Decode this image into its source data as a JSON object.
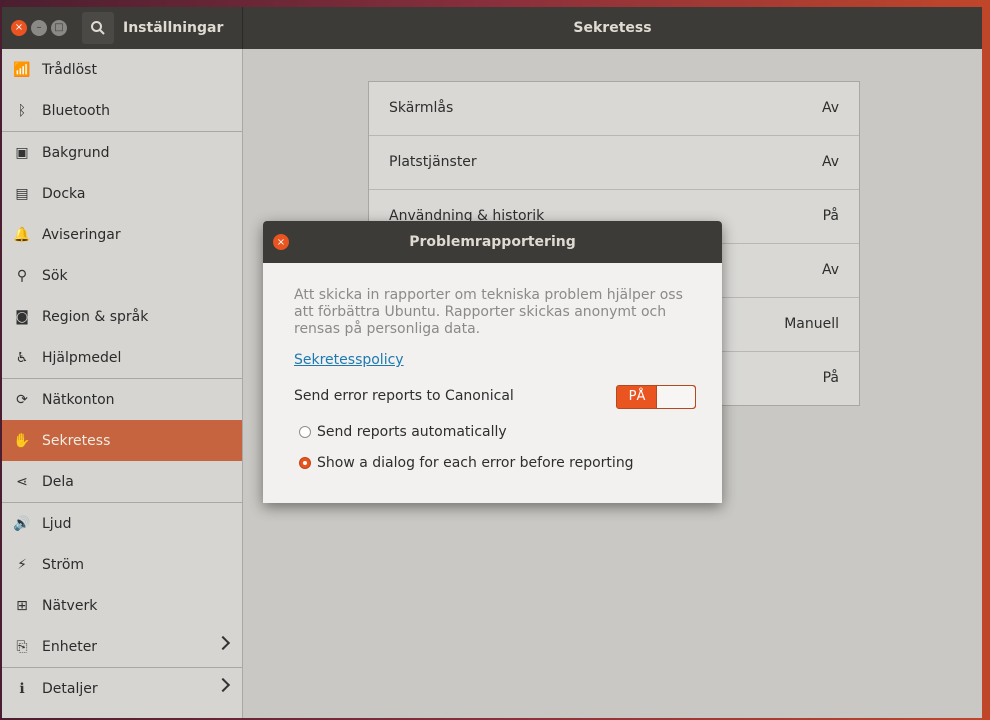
{
  "app": {
    "title": "Inställningar",
    "page_title": "Sekretess"
  },
  "window_controls": {
    "close": "×",
    "minimize": "–",
    "maximize": "□"
  },
  "sidebar": {
    "items": [
      {
        "label": "Trådlöst",
        "icon": "wifi-icon",
        "glyph": "📶"
      },
      {
        "label": "Bluetooth",
        "icon": "bluetooth-icon",
        "glyph": "ᛒ"
      },
      {
        "label": "Bakgrund",
        "icon": "background-icon",
        "glyph": "▣"
      },
      {
        "label": "Docka",
        "icon": "dock-icon",
        "glyph": "▤"
      },
      {
        "label": "Aviseringar",
        "icon": "bell-icon",
        "glyph": "🔔"
      },
      {
        "label": "Sök",
        "icon": "search-icon",
        "glyph": "⚲"
      },
      {
        "label": "Region & språk",
        "icon": "camera-icon",
        "glyph": "◙"
      },
      {
        "label": "Hjälpmedel",
        "icon": "accessibility-icon",
        "glyph": "♿"
      },
      {
        "label": "Nätkonton",
        "icon": "online-accounts-icon",
        "glyph": "⟳"
      },
      {
        "label": "Sekretess",
        "icon": "hand-icon",
        "glyph": "✋"
      },
      {
        "label": "Dela",
        "icon": "share-icon",
        "glyph": "⋖"
      },
      {
        "label": "Ljud",
        "icon": "speaker-icon",
        "glyph": "🔊"
      },
      {
        "label": "Ström",
        "icon": "power-icon",
        "glyph": "⚡"
      },
      {
        "label": "Nätverk",
        "icon": "network-icon",
        "glyph": "⊞"
      },
      {
        "label": "Enheter",
        "icon": "devices-icon",
        "glyph": "⎘"
      },
      {
        "label": "Detaljer",
        "icon": "info-icon",
        "glyph": "ℹ"
      }
    ]
  },
  "privacy_list": [
    {
      "label": "Skärmlås",
      "value": "Av"
    },
    {
      "label": "Platstjänster",
      "value": "Av"
    },
    {
      "label": "Användning & historik",
      "value": "På"
    },
    {
      "label": "",
      "value": "Av"
    },
    {
      "label": "",
      "value": "Manuell"
    },
    {
      "label": "",
      "value": "På"
    }
  ],
  "dialog": {
    "title": "Problemrapportering",
    "description": "Att skicka in rapporter om tekniska problem hjälper oss att förbättra Ubuntu. Rapporter skickas anonymt och rensas på personliga data.",
    "link": "Sekretesspolicy",
    "switch_label": "Send error reports to Canonical",
    "switch_state": "PÅ",
    "radio_auto": "Send reports automatically",
    "radio_dialog": "Show a dialog for each error before reporting"
  },
  "colors": {
    "accent": "#e95420",
    "titlebar": "#3c3b37",
    "selected": "#c5643e"
  }
}
